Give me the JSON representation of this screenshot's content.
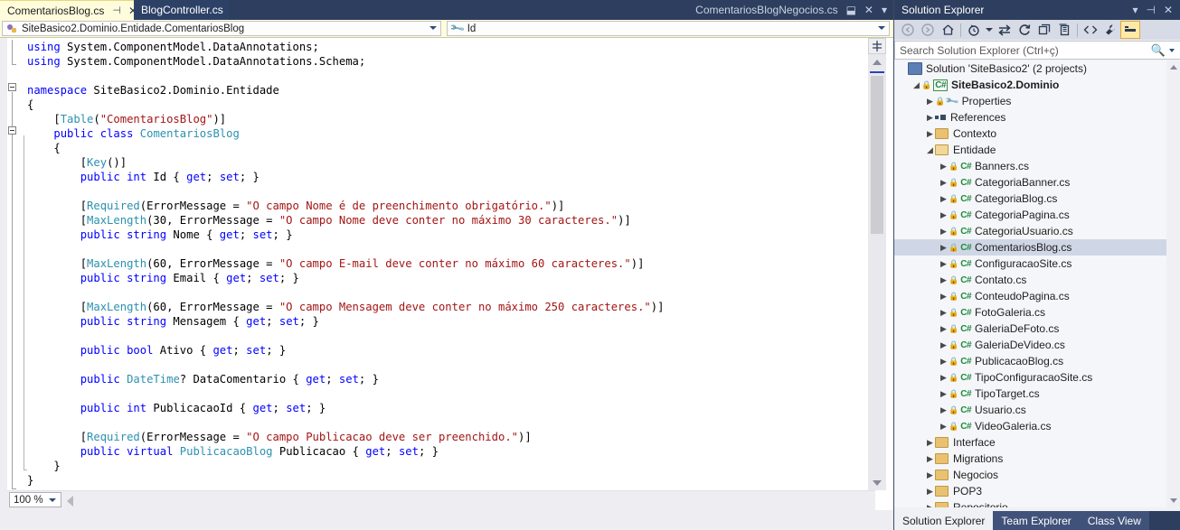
{
  "window": {
    "editor_tabs": [
      {
        "label": "ComentariosBlog.cs",
        "active": true,
        "pin": "⊣",
        "close": "✕"
      },
      {
        "label": "BlogController.cs",
        "active": false
      }
    ],
    "doc_well_right": {
      "label": "ComentariosBlogNegocios.cs",
      "restore_icon": "⬓",
      "close_icon": "✕",
      "dropdown_icon": "▾"
    }
  },
  "navbar": {
    "type_selector": {
      "value": "SiteBasico2.Dominio.Entidade.ComentariosBlog",
      "icon": "class-icon",
      "dropdown": "▾"
    },
    "member_selector": {
      "value": "Id",
      "icon": "property-wrench-icon",
      "dropdown": "▾"
    }
  },
  "code": {
    "language": "csharp",
    "lines": [
      [
        {
          "t": "k",
          "v": "using"
        },
        {
          "t": "n",
          "v": " System.ComponentModel.DataAnnotations;"
        }
      ],
      [
        {
          "t": "k",
          "v": "using"
        },
        {
          "t": "n",
          "v": " System.ComponentModel.DataAnnotations.Schema;"
        }
      ],
      [],
      [
        {
          "t": "k",
          "v": "namespace"
        },
        {
          "t": "n",
          "v": " SiteBasico2.Dominio.Entidade"
        }
      ],
      [
        {
          "t": "n",
          "v": "{"
        }
      ],
      [
        {
          "t": "n",
          "v": "    ["
        },
        {
          "t": "t",
          "v": "Table"
        },
        {
          "t": "n",
          "v": "("
        },
        {
          "t": "s",
          "v": "\"ComentariosBlog\""
        },
        {
          "t": "n",
          "v": ")]"
        }
      ],
      [
        {
          "t": "n",
          "v": "    "
        },
        {
          "t": "k",
          "v": "public class"
        },
        {
          "t": "n",
          "v": " "
        },
        {
          "t": "t",
          "v": "ComentariosBlog"
        }
      ],
      [
        {
          "t": "n",
          "v": "    {"
        }
      ],
      [
        {
          "t": "n",
          "v": "        ["
        },
        {
          "t": "t",
          "v": "Key"
        },
        {
          "t": "n",
          "v": "()]"
        }
      ],
      [
        {
          "t": "n",
          "v": "        "
        },
        {
          "t": "k",
          "v": "public int"
        },
        {
          "t": "n",
          "v": " Id { "
        },
        {
          "t": "k",
          "v": "get"
        },
        {
          "t": "n",
          "v": "; "
        },
        {
          "t": "k",
          "v": "set"
        },
        {
          "t": "n",
          "v": "; }"
        }
      ],
      [],
      [
        {
          "t": "n",
          "v": "        ["
        },
        {
          "t": "t",
          "v": "Required"
        },
        {
          "t": "n",
          "v": "(ErrorMessage = "
        },
        {
          "t": "s",
          "v": "\"O campo Nome é de preenchimento obrigatório.\""
        },
        {
          "t": "n",
          "v": ")]"
        }
      ],
      [
        {
          "t": "n",
          "v": "        ["
        },
        {
          "t": "t",
          "v": "MaxLength"
        },
        {
          "t": "n",
          "v": "(30, ErrorMessage = "
        },
        {
          "t": "s",
          "v": "\"O campo Nome deve conter no máximo 30 caracteres.\""
        },
        {
          "t": "n",
          "v": ")]"
        }
      ],
      [
        {
          "t": "n",
          "v": "        "
        },
        {
          "t": "k",
          "v": "public string"
        },
        {
          "t": "n",
          "v": " Nome { "
        },
        {
          "t": "k",
          "v": "get"
        },
        {
          "t": "n",
          "v": "; "
        },
        {
          "t": "k",
          "v": "set"
        },
        {
          "t": "n",
          "v": "; }"
        }
      ],
      [],
      [
        {
          "t": "n",
          "v": "        ["
        },
        {
          "t": "t",
          "v": "MaxLength"
        },
        {
          "t": "n",
          "v": "(60, ErrorMessage = "
        },
        {
          "t": "s",
          "v": "\"O campo E-mail deve conter no máximo 60 caracteres.\""
        },
        {
          "t": "n",
          "v": ")]"
        }
      ],
      [
        {
          "t": "n",
          "v": "        "
        },
        {
          "t": "k",
          "v": "public string"
        },
        {
          "t": "n",
          "v": " Email { "
        },
        {
          "t": "k",
          "v": "get"
        },
        {
          "t": "n",
          "v": "; "
        },
        {
          "t": "k",
          "v": "set"
        },
        {
          "t": "n",
          "v": "; }"
        }
      ],
      [],
      [
        {
          "t": "n",
          "v": "        ["
        },
        {
          "t": "t",
          "v": "MaxLength"
        },
        {
          "t": "n",
          "v": "(60, ErrorMessage = "
        },
        {
          "t": "s",
          "v": "\"O campo Mensagem deve conter no máximo 250 caracteres.\""
        },
        {
          "t": "n",
          "v": ")]"
        }
      ],
      [
        {
          "t": "n",
          "v": "        "
        },
        {
          "t": "k",
          "v": "public string"
        },
        {
          "t": "n",
          "v": " Mensagem { "
        },
        {
          "t": "k",
          "v": "get"
        },
        {
          "t": "n",
          "v": "; "
        },
        {
          "t": "k",
          "v": "set"
        },
        {
          "t": "n",
          "v": "; }"
        }
      ],
      [],
      [
        {
          "t": "n",
          "v": "        "
        },
        {
          "t": "k",
          "v": "public bool"
        },
        {
          "t": "n",
          "v": " Ativo { "
        },
        {
          "t": "k",
          "v": "get"
        },
        {
          "t": "n",
          "v": "; "
        },
        {
          "t": "k",
          "v": "set"
        },
        {
          "t": "n",
          "v": "; }"
        }
      ],
      [],
      [
        {
          "t": "n",
          "v": "        "
        },
        {
          "t": "k",
          "v": "public"
        },
        {
          "t": "n",
          "v": " "
        },
        {
          "t": "t",
          "v": "DateTime"
        },
        {
          "t": "n",
          "v": "? DataComentario { "
        },
        {
          "t": "k",
          "v": "get"
        },
        {
          "t": "n",
          "v": "; "
        },
        {
          "t": "k",
          "v": "set"
        },
        {
          "t": "n",
          "v": "; }"
        }
      ],
      [],
      [
        {
          "t": "n",
          "v": "        "
        },
        {
          "t": "k",
          "v": "public int"
        },
        {
          "t": "n",
          "v": " PublicacaoId { "
        },
        {
          "t": "k",
          "v": "get"
        },
        {
          "t": "n",
          "v": "; "
        },
        {
          "t": "k",
          "v": "set"
        },
        {
          "t": "n",
          "v": "; }"
        }
      ],
      [],
      [
        {
          "t": "n",
          "v": "        ["
        },
        {
          "t": "t",
          "v": "Required"
        },
        {
          "t": "n",
          "v": "(ErrorMessage = "
        },
        {
          "t": "s",
          "v": "\"O campo Publicacao deve ser preenchido.\""
        },
        {
          "t": "n",
          "v": ")]"
        }
      ],
      [
        {
          "t": "n",
          "v": "        "
        },
        {
          "t": "k",
          "v": "public virtual"
        },
        {
          "t": "n",
          "v": " "
        },
        {
          "t": "t",
          "v": "PublicacaoBlog"
        },
        {
          "t": "n",
          "v": " Publicacao { "
        },
        {
          "t": "k",
          "v": "get"
        },
        {
          "t": "n",
          "v": "; "
        },
        {
          "t": "k",
          "v": "set"
        },
        {
          "t": "n",
          "v": "; }"
        }
      ],
      [
        {
          "t": "n",
          "v": "    }"
        }
      ],
      [
        {
          "t": "n",
          "v": "}"
        }
      ]
    ]
  },
  "status": {
    "zoom_level": "100 %",
    "zoom_dropdown": "▾"
  },
  "solution_explorer": {
    "title": "Solution Explorer",
    "title_buttons": [
      {
        "name": "dropdown-icon",
        "glyph": "▾"
      },
      {
        "name": "pin-icon",
        "glyph": "⊣"
      },
      {
        "name": "close-icon",
        "glyph": "✕"
      }
    ],
    "toolbar": [
      {
        "name": "back-button",
        "glyph": "◉",
        "state": "disabled"
      },
      {
        "name": "forward-button",
        "glyph": "◉",
        "state": "disabled"
      },
      {
        "name": "home-button",
        "glyph": "⌂",
        "state": "enabled"
      },
      {
        "name": "pending-changes-filter-button",
        "glyph": "◔",
        "state": "enabled"
      },
      {
        "name": "sync-with-active-document-button",
        "glyph": "⇄",
        "state": "enabled"
      },
      {
        "name": "refresh-button",
        "glyph": "↻",
        "state": "enabled"
      },
      {
        "name": "collapse-all-button",
        "glyph": "❐",
        "state": "enabled"
      },
      {
        "name": "show-all-files-button",
        "glyph": "▤",
        "state": "enabled"
      },
      {
        "name": "view-code-button",
        "glyph": "<>",
        "state": "enabled"
      },
      {
        "name": "properties-button",
        "glyph": "🔧",
        "state": "enabled"
      },
      {
        "name": "preview-selected-items-button",
        "glyph": "▬",
        "state": "active"
      }
    ],
    "search_placeholder": "Search Solution Explorer (Ctrl+ç)",
    "tree": [
      {
        "indent": 0,
        "expander": "",
        "icon": "solution-icon",
        "label": "Solution 'SiteBasico2' (2 projects)",
        "bold": false,
        "selected": false
      },
      {
        "indent": 1,
        "expander": "open",
        "icon": "csharp-project-icon",
        "label": "SiteBasico2.Dominio",
        "bold": true,
        "selected": false
      },
      {
        "indent": 2,
        "expander": "closed",
        "icon": "properties-icon",
        "label": "Properties",
        "bold": false,
        "selected": false
      },
      {
        "indent": 2,
        "expander": "closed",
        "icon": "references-icon",
        "label": "References",
        "bold": false,
        "selected": false
      },
      {
        "indent": 2,
        "expander": "closed",
        "icon": "folder-icon",
        "label": "Contexto",
        "bold": false,
        "selected": false
      },
      {
        "indent": 2,
        "expander": "open",
        "icon": "folder-open-icon",
        "label": "Entidade",
        "bold": false,
        "selected": false
      },
      {
        "indent": 3,
        "expander": "closed",
        "icon": "csharp-file-icon",
        "label": "Banners.cs",
        "bold": false,
        "selected": false
      },
      {
        "indent": 3,
        "expander": "closed",
        "icon": "csharp-file-icon",
        "label": "CategoriaBanner.cs",
        "bold": false,
        "selected": false
      },
      {
        "indent": 3,
        "expander": "closed",
        "icon": "csharp-file-icon",
        "label": "CategoriaBlog.cs",
        "bold": false,
        "selected": false
      },
      {
        "indent": 3,
        "expander": "closed",
        "icon": "csharp-file-icon",
        "label": "CategoriaPagina.cs",
        "bold": false,
        "selected": false
      },
      {
        "indent": 3,
        "expander": "closed",
        "icon": "csharp-file-icon",
        "label": "CategoriaUsuario.cs",
        "bold": false,
        "selected": false
      },
      {
        "indent": 3,
        "expander": "closed",
        "icon": "csharp-file-icon",
        "label": "ComentariosBlog.cs",
        "bold": false,
        "selected": true
      },
      {
        "indent": 3,
        "expander": "closed",
        "icon": "csharp-file-icon",
        "label": "ConfiguracaoSite.cs",
        "bold": false,
        "selected": false
      },
      {
        "indent": 3,
        "expander": "closed",
        "icon": "csharp-file-icon",
        "label": "Contato.cs",
        "bold": false,
        "selected": false
      },
      {
        "indent": 3,
        "expander": "closed",
        "icon": "csharp-file-icon",
        "label": "ConteudoPagina.cs",
        "bold": false,
        "selected": false
      },
      {
        "indent": 3,
        "expander": "closed",
        "icon": "csharp-file-icon",
        "label": "FotoGaleria.cs",
        "bold": false,
        "selected": false
      },
      {
        "indent": 3,
        "expander": "closed",
        "icon": "csharp-file-icon",
        "label": "GaleriaDeFoto.cs",
        "bold": false,
        "selected": false
      },
      {
        "indent": 3,
        "expander": "closed",
        "icon": "csharp-file-icon",
        "label": "GaleriaDeVideo.cs",
        "bold": false,
        "selected": false
      },
      {
        "indent": 3,
        "expander": "closed",
        "icon": "csharp-file-icon",
        "label": "PublicacaoBlog.cs",
        "bold": false,
        "selected": false
      },
      {
        "indent": 3,
        "expander": "closed",
        "icon": "csharp-file-icon",
        "label": "TipoConfiguracaoSite.cs",
        "bold": false,
        "selected": false
      },
      {
        "indent": 3,
        "expander": "closed",
        "icon": "csharp-file-icon",
        "label": "TipoTarget.cs",
        "bold": false,
        "selected": false
      },
      {
        "indent": 3,
        "expander": "closed",
        "icon": "csharp-file-icon",
        "label": "Usuario.cs",
        "bold": false,
        "selected": false
      },
      {
        "indent": 3,
        "expander": "closed",
        "icon": "csharp-file-icon",
        "label": "VideoGaleria.cs",
        "bold": false,
        "selected": false
      },
      {
        "indent": 2,
        "expander": "closed",
        "icon": "folder-icon",
        "label": "Interface",
        "bold": false,
        "selected": false
      },
      {
        "indent": 2,
        "expander": "closed",
        "icon": "folder-icon",
        "label": "Migrations",
        "bold": false,
        "selected": false
      },
      {
        "indent": 2,
        "expander": "closed",
        "icon": "folder-icon",
        "label": "Negocios",
        "bold": false,
        "selected": false
      },
      {
        "indent": 2,
        "expander": "closed",
        "icon": "folder-icon",
        "label": "POP3",
        "bold": false,
        "selected": false
      },
      {
        "indent": 2,
        "expander": "closed",
        "icon": "folder-icon",
        "label": "Repositorio",
        "bold": false,
        "selected": false
      }
    ],
    "bottom_tabs": [
      {
        "label": "Solution Explorer",
        "active": true
      },
      {
        "label": "Team Explorer",
        "active": false
      },
      {
        "label": "Class View",
        "active": false
      }
    ]
  },
  "colors": {
    "chrome_blue": "#2d3e5f",
    "active_tab_yellow": "#fffcdc",
    "keyword": "#0000ff",
    "type": "#2b91af",
    "string": "#a31515",
    "selection_row": "#cfd6e6",
    "toolbar_bg": "#d6dbe6"
  }
}
